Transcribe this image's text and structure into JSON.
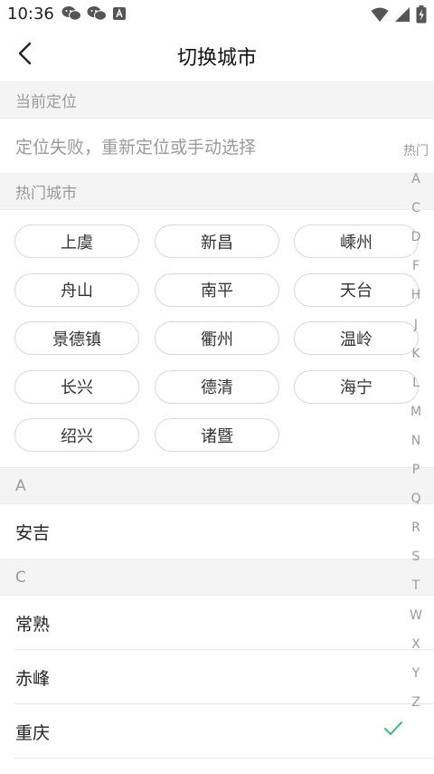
{
  "status_bar": {
    "time": "10:36",
    "left_icons": [
      "wechat-icon",
      "wechat-icon",
      "font-a-icon"
    ],
    "right_icons": [
      "wifi-icon",
      "signal-icon",
      "battery-charging-icon"
    ]
  },
  "header": {
    "back_icon": "chevron-left-icon",
    "title": "切换城市"
  },
  "current_location": {
    "section_title": "当前定位",
    "status_text": "定位失败，重新定位或手动选择"
  },
  "hot_cities": {
    "section_title": "热门城市",
    "items": [
      "上虞",
      "新昌",
      "嵊州",
      "舟山",
      "南平",
      "天台",
      "景德镇",
      "衢州",
      "温岭",
      "长兴",
      "德清",
      "海宁",
      "绍兴",
      "诸暨"
    ]
  },
  "city_groups": [
    {
      "letter": "A",
      "cities": [
        "安吉"
      ]
    },
    {
      "letter": "C",
      "cities": [
        "常熟",
        "赤峰",
        "重庆"
      ]
    }
  ],
  "selected_city": "重庆",
  "index_bar": {
    "items": [
      "热门",
      "A",
      "C",
      "D",
      "F",
      "H",
      "J",
      "K",
      "L",
      "M",
      "N",
      "P",
      "Q",
      "R",
      "S",
      "T",
      "W",
      "X",
      "Y",
      "Z"
    ]
  },
  "colors": {
    "accent_check": "#2bb673",
    "section_bg": "#f4f4f4",
    "muted_text": "#9a9a9a"
  }
}
